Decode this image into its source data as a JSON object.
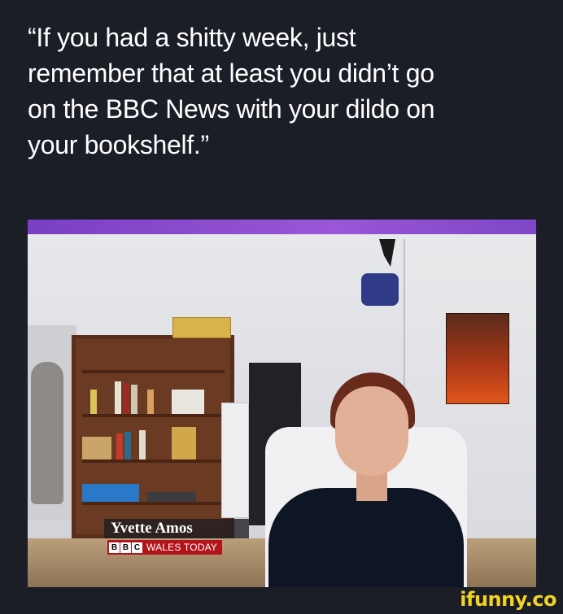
{
  "post": {
    "quote_lines": [
      "“If you had a shitty week, just",
      "remember that at least you didn’t go",
      "on the BBC News with your dildo on",
      "your bookshelf.”"
    ]
  },
  "video": {
    "name_caption": "Yvette Amos",
    "channel_letters": [
      "B",
      "B",
      "C"
    ],
    "program": "WALES TODAY",
    "colors": {
      "bar": "#8a4fd0",
      "strap": "#b3131a"
    }
  },
  "watermark": {
    "text": "ifunny.co"
  }
}
